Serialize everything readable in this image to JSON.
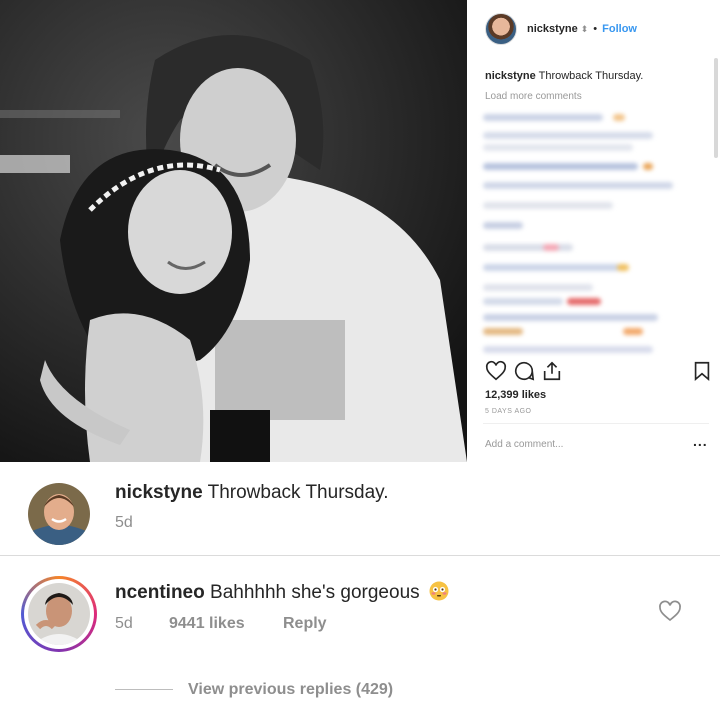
{
  "post": {
    "username": "nickstyne",
    "sort_glyph": "⬍",
    "follow_label": "Follow",
    "caption_user": "nickstyne",
    "caption_text": "Throwback Thursday.",
    "load_more": "Load more comments",
    "likes": "12,399 likes",
    "time_ago": "5 DAYS AGO",
    "add_comment_placeholder": "Add a comment...",
    "more_glyph": "..."
  },
  "comments": [
    {
      "username": "nickstyne",
      "text": "Throwback Thursday.",
      "age": "5d"
    },
    {
      "username": "ncentineo",
      "text": "Bahhhhh she's gorgeous",
      "emoji": "flushed-face-icon",
      "age": "5d",
      "likes": "9441 likes",
      "reply_label": "Reply",
      "view_replies": "View previous replies (429)"
    }
  ],
  "colors": {
    "accent_blue": "#3897f0",
    "text_dark": "#262626",
    "text_muted": "#8e8e8e"
  }
}
